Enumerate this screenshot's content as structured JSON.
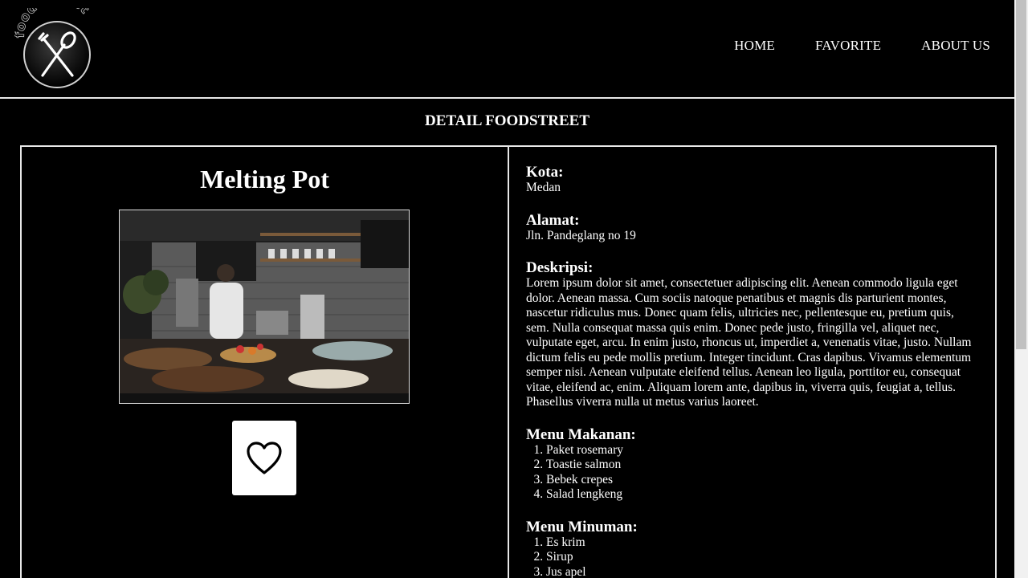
{
  "header": {
    "logo_text": "food street",
    "nav": [
      {
        "label": "HOME"
      },
      {
        "label": "FAVORITE"
      },
      {
        "label": "ABOUT US"
      }
    ]
  },
  "page": {
    "section_title": "DETAIL FOODSTREET"
  },
  "restaurant": {
    "name": "Melting Pot",
    "favorite_icon": "heart-outline-icon",
    "kota_label": "Kota:",
    "kota": "Medan",
    "alamat_label": "Alamat:",
    "alamat": "Jln. Pandeglang no 19",
    "deskripsi_label": "Deskripsi:",
    "deskripsi": "Lorem ipsum dolor sit amet, consectetuer adipiscing elit. Aenean commodo ligula eget dolor. Aenean massa. Cum sociis natoque penatibus et magnis dis parturient montes, nascetur ridiculus mus. Donec quam felis, ultricies nec, pellentesque eu, pretium quis, sem. Nulla consequat massa quis enim. Donec pede justo, fringilla vel, aliquet nec, vulputate eget, arcu. In enim justo, rhoncus ut, imperdiet a, venenatis vitae, justo. Nullam dictum felis eu pede mollis pretium. Integer tincidunt. Cras dapibus. Vivamus elementum semper nisi. Aenean vulputate eleifend tellus. Aenean leo ligula, porttitor eu, consequat vitae, eleifend ac, enim. Aliquam lorem ante, dapibus in, viverra quis, feugiat a, tellus. Phasellus viverra nulla ut metus varius laoreet.",
    "makanan_label": "Menu Makanan:",
    "makanan": [
      "Paket rosemary",
      "Toastie salmon",
      "Bebek crepes",
      "Salad lengkeng"
    ],
    "minuman_label": "Menu Minuman:",
    "minuman": [
      "Es krim",
      "Sirup",
      "Jus apel"
    ]
  },
  "colors": {
    "background": "#000000",
    "text": "#ffffff",
    "border": "#e8e8e8"
  }
}
